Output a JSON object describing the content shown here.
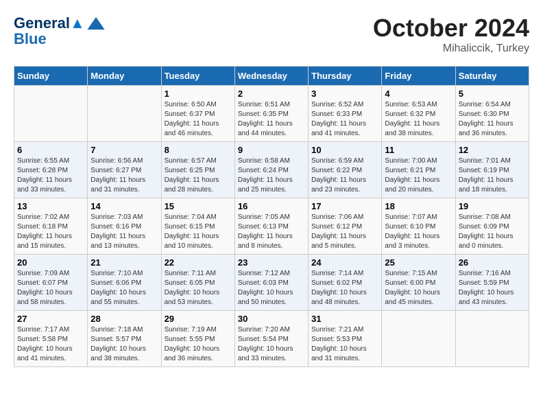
{
  "logo": {
    "line1": "General",
    "line2": "Blue"
  },
  "title": "October 2024",
  "subtitle": "Mihaliccik, Turkey",
  "days_of_week": [
    "Sunday",
    "Monday",
    "Tuesday",
    "Wednesday",
    "Thursday",
    "Friday",
    "Saturday"
  ],
  "weeks": [
    [
      {
        "day": "",
        "info": ""
      },
      {
        "day": "",
        "info": ""
      },
      {
        "day": "1",
        "info": "Sunrise: 6:50 AM\nSunset: 6:37 PM\nDaylight: 11 hours and 46 minutes."
      },
      {
        "day": "2",
        "info": "Sunrise: 6:51 AM\nSunset: 6:35 PM\nDaylight: 11 hours and 44 minutes."
      },
      {
        "day": "3",
        "info": "Sunrise: 6:52 AM\nSunset: 6:33 PM\nDaylight: 11 hours and 41 minutes."
      },
      {
        "day": "4",
        "info": "Sunrise: 6:53 AM\nSunset: 6:32 PM\nDaylight: 11 hours and 38 minutes."
      },
      {
        "day": "5",
        "info": "Sunrise: 6:54 AM\nSunset: 6:30 PM\nDaylight: 11 hours and 36 minutes."
      }
    ],
    [
      {
        "day": "6",
        "info": "Sunrise: 6:55 AM\nSunset: 6:28 PM\nDaylight: 11 hours and 33 minutes."
      },
      {
        "day": "7",
        "info": "Sunrise: 6:56 AM\nSunset: 6:27 PM\nDaylight: 11 hours and 31 minutes."
      },
      {
        "day": "8",
        "info": "Sunrise: 6:57 AM\nSunset: 6:25 PM\nDaylight: 11 hours and 28 minutes."
      },
      {
        "day": "9",
        "info": "Sunrise: 6:58 AM\nSunset: 6:24 PM\nDaylight: 11 hours and 25 minutes."
      },
      {
        "day": "10",
        "info": "Sunrise: 6:59 AM\nSunset: 6:22 PM\nDaylight: 11 hours and 23 minutes."
      },
      {
        "day": "11",
        "info": "Sunrise: 7:00 AM\nSunset: 6:21 PM\nDaylight: 11 hours and 20 minutes."
      },
      {
        "day": "12",
        "info": "Sunrise: 7:01 AM\nSunset: 6:19 PM\nDaylight: 11 hours and 18 minutes."
      }
    ],
    [
      {
        "day": "13",
        "info": "Sunrise: 7:02 AM\nSunset: 6:18 PM\nDaylight: 11 hours and 15 minutes."
      },
      {
        "day": "14",
        "info": "Sunrise: 7:03 AM\nSunset: 6:16 PM\nDaylight: 11 hours and 13 minutes."
      },
      {
        "day": "15",
        "info": "Sunrise: 7:04 AM\nSunset: 6:15 PM\nDaylight: 11 hours and 10 minutes."
      },
      {
        "day": "16",
        "info": "Sunrise: 7:05 AM\nSunset: 6:13 PM\nDaylight: 11 hours and 8 minutes."
      },
      {
        "day": "17",
        "info": "Sunrise: 7:06 AM\nSunset: 6:12 PM\nDaylight: 11 hours and 5 minutes."
      },
      {
        "day": "18",
        "info": "Sunrise: 7:07 AM\nSunset: 6:10 PM\nDaylight: 11 hours and 3 minutes."
      },
      {
        "day": "19",
        "info": "Sunrise: 7:08 AM\nSunset: 6:09 PM\nDaylight: 11 hours and 0 minutes."
      }
    ],
    [
      {
        "day": "20",
        "info": "Sunrise: 7:09 AM\nSunset: 6:07 PM\nDaylight: 10 hours and 58 minutes."
      },
      {
        "day": "21",
        "info": "Sunrise: 7:10 AM\nSunset: 6:06 PM\nDaylight: 10 hours and 55 minutes."
      },
      {
        "day": "22",
        "info": "Sunrise: 7:11 AM\nSunset: 6:05 PM\nDaylight: 10 hours and 53 minutes."
      },
      {
        "day": "23",
        "info": "Sunrise: 7:12 AM\nSunset: 6:03 PM\nDaylight: 10 hours and 50 minutes."
      },
      {
        "day": "24",
        "info": "Sunrise: 7:14 AM\nSunset: 6:02 PM\nDaylight: 10 hours and 48 minutes."
      },
      {
        "day": "25",
        "info": "Sunrise: 7:15 AM\nSunset: 6:00 PM\nDaylight: 10 hours and 45 minutes."
      },
      {
        "day": "26",
        "info": "Sunrise: 7:16 AM\nSunset: 5:59 PM\nDaylight: 10 hours and 43 minutes."
      }
    ],
    [
      {
        "day": "27",
        "info": "Sunrise: 7:17 AM\nSunset: 5:58 PM\nDaylight: 10 hours and 41 minutes."
      },
      {
        "day": "28",
        "info": "Sunrise: 7:18 AM\nSunset: 5:57 PM\nDaylight: 10 hours and 38 minutes."
      },
      {
        "day": "29",
        "info": "Sunrise: 7:19 AM\nSunset: 5:55 PM\nDaylight: 10 hours and 36 minutes."
      },
      {
        "day": "30",
        "info": "Sunrise: 7:20 AM\nSunset: 5:54 PM\nDaylight: 10 hours and 33 minutes."
      },
      {
        "day": "31",
        "info": "Sunrise: 7:21 AM\nSunset: 5:53 PM\nDaylight: 10 hours and 31 minutes."
      },
      {
        "day": "",
        "info": ""
      },
      {
        "day": "",
        "info": ""
      }
    ]
  ]
}
